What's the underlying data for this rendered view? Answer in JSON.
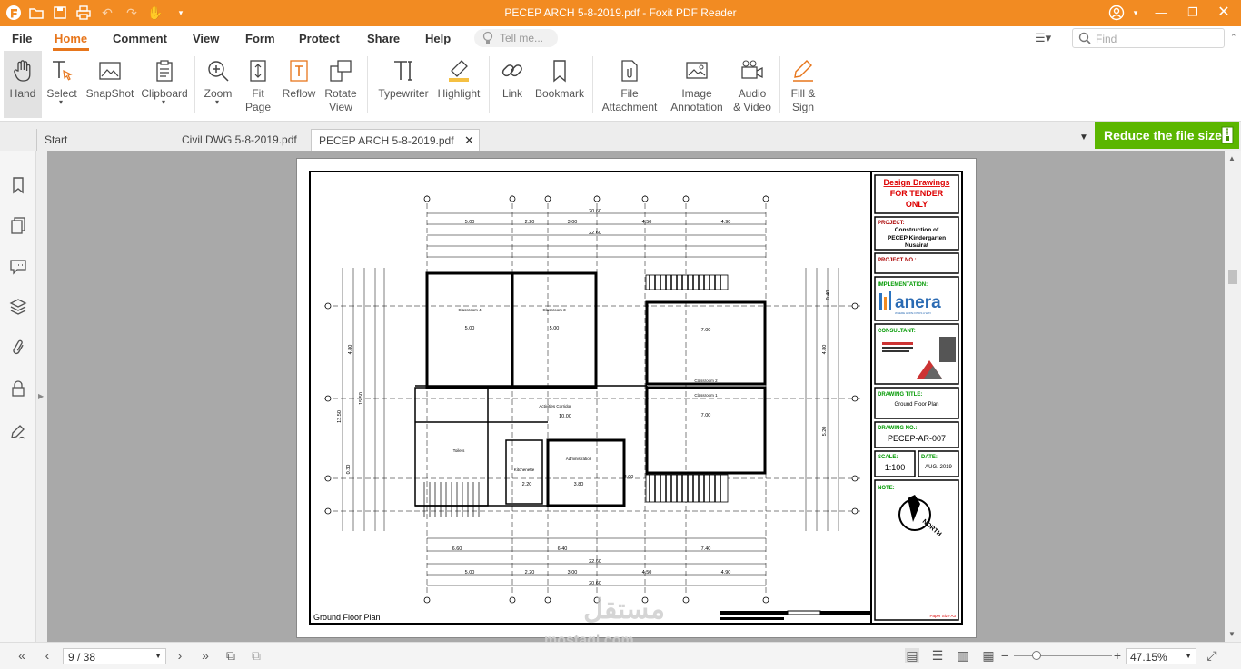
{
  "window": {
    "title": "PECEP ARCH 5-8-2019.pdf - Foxit PDF Reader"
  },
  "menu": {
    "items": [
      "File",
      "Home",
      "Comment",
      "View",
      "Form",
      "Protect",
      "Share",
      "Help"
    ],
    "active": "Home",
    "tell_me_placeholder": "Tell me...",
    "find_placeholder": "Find"
  },
  "ribbon": {
    "hand": "Hand",
    "select": "Select",
    "snapshot": "SnapShot",
    "clipboard": "Clipboard",
    "zoom": "Zoom",
    "fit_page_1": "Fit",
    "fit_page_2": "Page",
    "reflow": "Reflow",
    "rotate_1": "Rotate",
    "rotate_2": "View",
    "typewriter": "Typewriter",
    "highlight": "Highlight",
    "link": "Link",
    "bookmark": "Bookmark",
    "file_att_1": "File",
    "file_att_2": "Attachment",
    "image_ann_1": "Image",
    "image_ann_2": "Annotation",
    "audio_1": "Audio",
    "audio_2": "& Video",
    "fill_1": "Fill &",
    "fill_2": "Sign"
  },
  "tabs": [
    "Start",
    "Civil DWG 5-8-2019.pdf",
    "PECEP ARCH 5-8-2019.pdf"
  ],
  "promo": "Reduce the file size",
  "drawing": {
    "title_block": {
      "header_1": "Design Drawings",
      "header_2": "FOR TENDER",
      "header_3": "ONLY",
      "project_label": "PROJECT:",
      "project_1": "Construction of",
      "project_2": "PECEP Kindergarten",
      "project_3": "Nusairat",
      "project_no_label": "PROJECT NO.:",
      "implementation_label": "IMPLEMENTATION:",
      "implementer": "anera",
      "implementer_tagline": "WHERE HOPE FINDS A WAY",
      "consultant_label": "CONSULTANT:",
      "drawing_title_label": "DRAWING TITLE:",
      "drawing_title": "Ground Floor Plan",
      "drawing_no_label": "DRAWING NO.:",
      "drawing_no": "PECEP-AR-007",
      "scale_label": "SCALE:",
      "scale": "1:100",
      "date_label": "DATE:",
      "date": "AUG. 2019",
      "note_label": "NOTE:",
      "north": "NORTH",
      "paper_size": "Paper Size A3"
    },
    "plan_title": "Ground Floor Plan",
    "rooms": [
      "Classroom 4",
      "Classroom 3",
      "Classroom 2",
      "Classroom 1",
      "Activities Corridor",
      "Toilets",
      "Kitchenette",
      "Administration"
    ],
    "dims_top": [
      "5.00",
      "2.20",
      "3.00",
      "4.50",
      "4.90"
    ],
    "dim_total_top": "22.60",
    "dim_sub_top": "20.60",
    "dims_bottom": [
      "5.00",
      "2.20",
      "3.00",
      "4.50",
      "4.90"
    ],
    "dim_total_bottom": "22.60",
    "dim_sub_bottom": "20.60",
    "dims_inner": [
      "5.00",
      "5.00",
      "7.00",
      "7.00",
      "10.00",
      "3.80",
      "2.20",
      "2.00"
    ],
    "dims_side": [
      "4.80",
      "15.50",
      "13.50",
      "4.80",
      "5.20",
      "0.40",
      "0.30"
    ],
    "row_600": [
      "6.60",
      "6.40",
      "7.40"
    ],
    "watermark_1": "مستقل",
    "watermark_2": "mostaql.com"
  },
  "status": {
    "page": "9 / 38",
    "zoom": "47.15%"
  }
}
